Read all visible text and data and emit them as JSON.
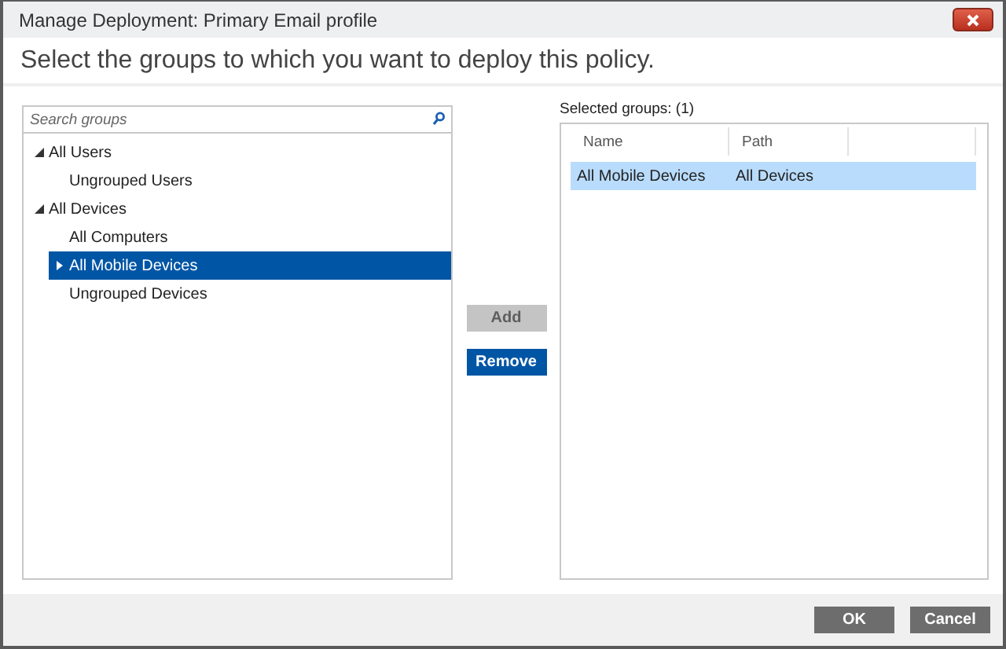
{
  "window": {
    "title": "Manage Deployment: Primary Email profile"
  },
  "heading": "Select the groups to which you want to deploy this policy.",
  "search": {
    "placeholder": "Search groups"
  },
  "tree": [
    {
      "label": "All Users",
      "kind": "node",
      "expanded": true,
      "selected": false,
      "children": [
        {
          "label": "Ungrouped Users",
          "kind": "leaf",
          "selected": false
        }
      ]
    },
    {
      "label": "All Devices",
      "kind": "node",
      "expanded": true,
      "selected": false,
      "children": [
        {
          "label": "All Computers",
          "kind": "leaf",
          "selected": false
        },
        {
          "label": "All Mobile Devices",
          "kind": "node",
          "expanded": false,
          "selected": true
        },
        {
          "label": "Ungrouped Devices",
          "kind": "leaf",
          "selected": false
        }
      ]
    }
  ],
  "actions": [
    {
      "label": "Add",
      "disabled": true
    },
    {
      "label": "Remove",
      "disabled": false
    }
  ],
  "selected_groups": {
    "label": "Selected groups: (1)",
    "columns": [
      "Name",
      "Path"
    ],
    "rows": [
      {
        "cells": [
          "All Mobile Devices",
          "All Devices"
        ],
        "selected": true
      }
    ]
  },
  "footer_buttons": [
    "OK",
    "Cancel"
  ]
}
